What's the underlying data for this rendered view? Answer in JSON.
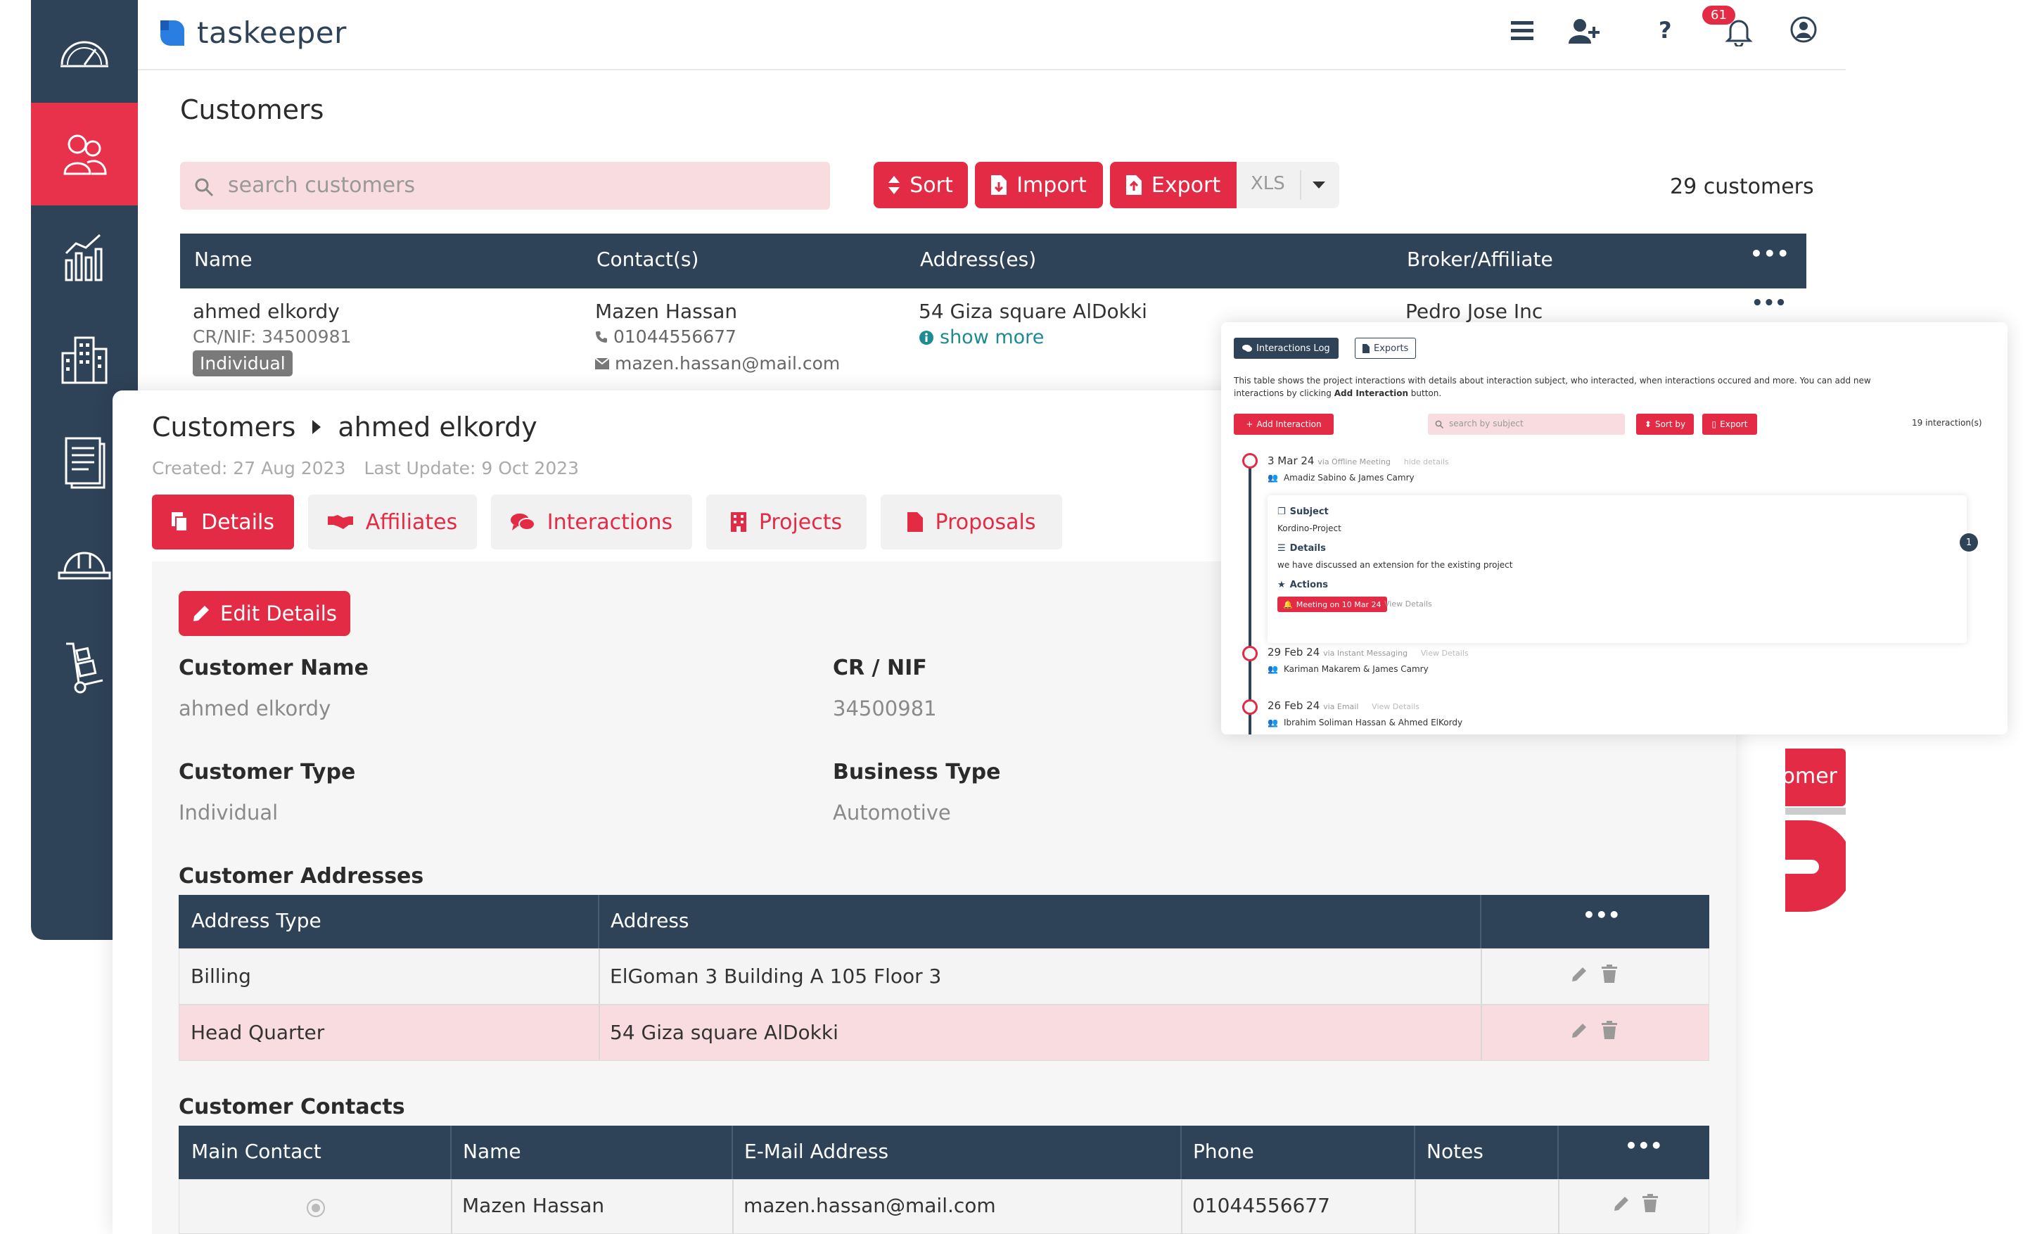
{
  "app": {
    "brand": "taskeeper",
    "notification_count": "61"
  },
  "colors": {
    "primary": "#e32b45",
    "navy": "#2e4258",
    "row_alt": "#f9dce0"
  },
  "sidebar": {
    "items": [
      {
        "icon": "dashboard-gauge-icon"
      },
      {
        "icon": "customers-icon",
        "active": true
      },
      {
        "icon": "analytics-chart-icon"
      },
      {
        "icon": "buildings-icon"
      },
      {
        "icon": "documents-icon"
      },
      {
        "icon": "helmet-icon"
      },
      {
        "icon": "hand-truck-icon"
      }
    ]
  },
  "customers_page": {
    "title": "Customers",
    "search_placeholder": "search customers",
    "sort_label": "Sort",
    "import_label": "Import",
    "export_label": "Export",
    "export_format": "XLS",
    "count": "29 customers",
    "columns": [
      "Name",
      "Contact(s)",
      "Address(es)",
      "Broker/Affiliate"
    ],
    "row": {
      "name": "ahmed elkordy",
      "cr": "CR/NIF: 34500981",
      "type_badge": "Individual",
      "contact_name": "Mazen Hassan",
      "phone": "01044556677",
      "email": "mazen.hassan@mail.com",
      "address": "54 Giza square AlDokki",
      "show_more": "show more",
      "broker": "Pedro Jose Inc"
    },
    "partial_button": "omer"
  },
  "detail": {
    "breadcrumb_root": "Customers",
    "breadcrumb_current": "ahmed elkordy",
    "created": "Created: 27 Aug 2023",
    "updated": "Last Update: 9 Oct 2023",
    "tabs": [
      "Details",
      "Affiliates",
      "Interactions",
      "Projects",
      "Proposals"
    ],
    "edit_label": "Edit Details",
    "fields": {
      "customer_name_label": "Customer Name",
      "customer_name": "ahmed elkordy",
      "cr_label": "CR / NIF",
      "cr": "34500981",
      "type_label": "Customer Type",
      "type": "Individual",
      "business_label": "Business Type",
      "business": "Automotive"
    },
    "addresses": {
      "title": "Customer Addresses",
      "columns": [
        "Address Type",
        "Address"
      ],
      "rows": [
        {
          "type": "Billing",
          "address": "ElGoman 3 Building A 105 Floor 3"
        },
        {
          "type": "Head Quarter",
          "address": "54 Giza square AlDokki"
        }
      ]
    },
    "contacts": {
      "title": "Customer Contacts",
      "columns": [
        "Main Contact",
        "Name",
        "E-Mail Address",
        "Phone",
        "Notes"
      ],
      "rows": [
        {
          "name": "Mazen Hassan",
          "email": "mazen.hassan@mail.com",
          "phone": "01044556677",
          "notes": ""
        }
      ]
    }
  },
  "interactions": {
    "tab_log": "Interactions Log",
    "tab_exports": "Exports",
    "description_1": "This table shows the project interactions with details about interaction subject, who interacted, when interactions occured and more. You can add new",
    "description_2a": "interactions by clicking ",
    "description_2b": "Add Interaction",
    "description_2c": " button.",
    "add_label": "Add Interaction",
    "search_placeholder": "search by subject",
    "sort_label": "Sort by",
    "export_label": "Export",
    "count": "19 interaction(s)",
    "page_badge": "1",
    "entries": [
      {
        "date": "3 Mar 24",
        "via": "via Offline Meeting",
        "toggle": "hide details",
        "people": "Amadiz Sabino & James Camry",
        "subject_label": "Subject",
        "subject": "Kordino-Project",
        "details_label": "Details",
        "details": "we have discussed an extension for the existing project",
        "actions_label": "Actions",
        "action": "Meeting on 10 Mar 24",
        "view": "View Details"
      },
      {
        "date": "29 Feb 24",
        "via": "via Instant Messaging",
        "toggle": "View Details",
        "people": "Kariman Makarem & James Camry"
      },
      {
        "date": "26 Feb 24",
        "via": "via Email",
        "toggle": "View Details",
        "people": "Ibrahim Soliman Hassan & Ahmed ElKordy"
      }
    ]
  }
}
